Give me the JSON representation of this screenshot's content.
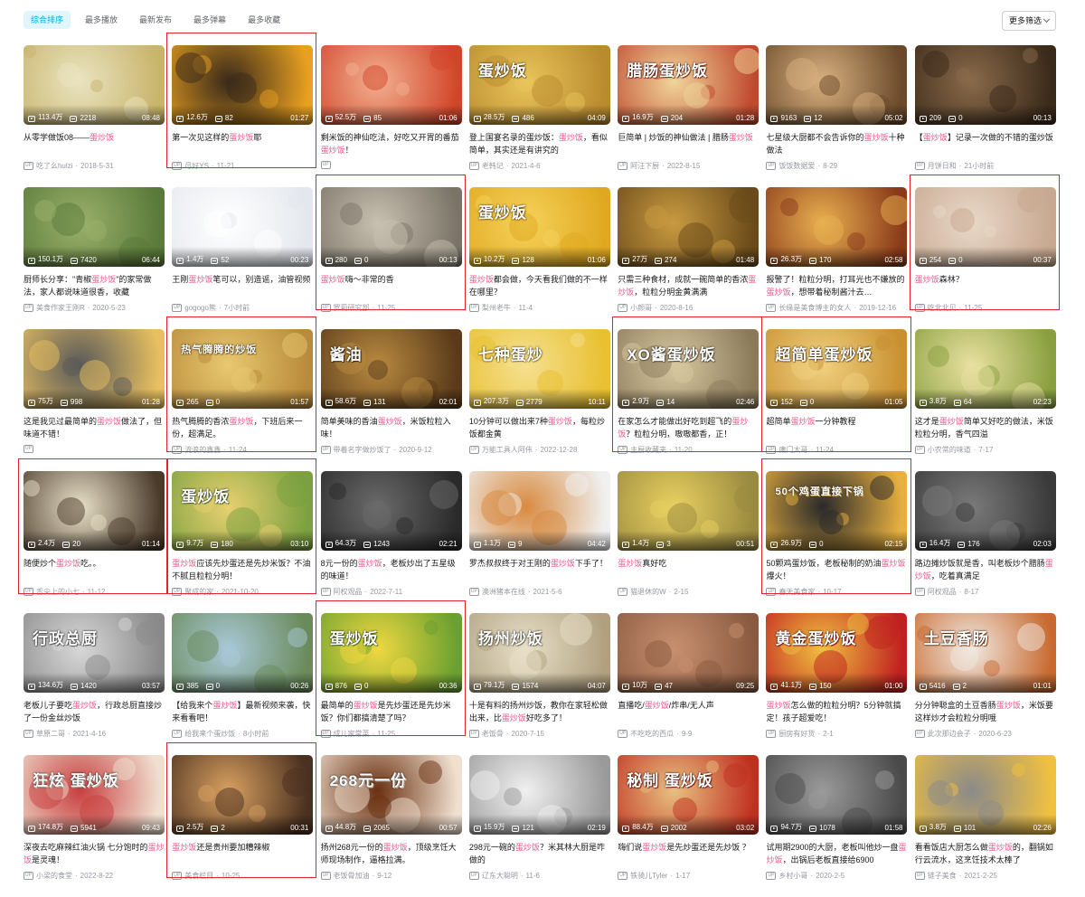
{
  "keyword": "蛋炒饭",
  "colors": {
    "accent": "#00aeec",
    "keyword": "#f25d8e",
    "highlight_box": "#e0242e"
  },
  "sort_tabs": [
    {
      "label": "综合排序",
      "active": true
    },
    {
      "label": "最多播放",
      "active": false
    },
    {
      "label": "最新发布",
      "active": false
    },
    {
      "label": "最多弹幕",
      "active": false
    },
    {
      "label": "最多收藏",
      "active": false
    }
  ],
  "filter_button": {
    "label": "更多筛选",
    "icon": "chevron-down-icon"
  },
  "videos": [
    {
      "title": [
        "从零学做饭08——",
        "蛋炒饭"
      ],
      "plays": "113.4万",
      "danmaku": "2218",
      "duration": "08:48",
      "author": "吃了么hulzi",
      "date": "2018-5-31",
      "highlighted": false,
      "thumb": {
        "c1": "#e9e3c0",
        "c2": "#c8b46a",
        "text": ""
      }
    },
    {
      "title": [
        "第一次见这样的",
        "蛋炒饭",
        "耶"
      ],
      "plays": "12.6万",
      "danmaku": "82",
      "duration": "01:27",
      "author": "尽好YS",
      "date": "11-21",
      "highlighted": true,
      "thumb": {
        "c1": "#3a2a1a",
        "c2": "#e8a020",
        "text": ""
      }
    },
    {
      "title": [
        "剩米饭的神仙吃法，好吃又开胃的番茄",
        "蛋炒饭",
        "！"
      ],
      "plays": "52.5万",
      "danmaku": "85",
      "duration": "01:06",
      "author": "",
      "date": "",
      "highlighted": false,
      "thumb": {
        "c1": "#f2b090",
        "c2": "#d2452a",
        "text": ""
      }
    },
    {
      "title": [
        "登上国宴名录的蛋炒饭：",
        "蛋炒饭",
        "，看似简单，其实还是有讲究的"
      ],
      "plays": "28.5万",
      "danmaku": "486",
      "duration": "04:09",
      "author": "老韩记",
      "date": "2021-4-6",
      "highlighted": false,
      "thumb": {
        "c1": "#e8c45a",
        "c2": "#b98a2e",
        "text": "蛋炒饭"
      }
    },
    {
      "title": [
        "巨简单 | 炒饭的神仙做法 | 腊肠",
        "蛋炒饭"
      ],
      "plays": "16.9万",
      "danmaku": "204",
      "duration": "01:28",
      "author": "阿汪下厨",
      "date": "2022-8-15",
      "highlighted": false,
      "thumb": {
        "c1": "#f0d59a",
        "c2": "#c0482e",
        "text": "腊肠蛋炒饭"
      }
    },
    {
      "title": [
        "七星级大厨都不会告诉你的",
        "蛋炒饭",
        "十种做法"
      ],
      "plays": "9163",
      "danmaku": "12",
      "duration": "05:02",
      "author": "饭饭数据爱",
      "date": "8-29",
      "highlighted": false,
      "thumb": {
        "c1": "#d8b080",
        "c2": "#6a4a2a",
        "text": ""
      }
    },
    {
      "title": [
        "【",
        "蛋炒饭",
        "】记录一次做的不错的蛋炒饭"
      ],
      "plays": "209",
      "danmaku": "0",
      "duration": "00:13",
      "author": "月饼日和",
      "date": "21小时前",
      "highlighted": false,
      "thumb": {
        "c1": "#8a6a4a",
        "c2": "#3a2a1a",
        "text": ""
      }
    },
    {
      "title": [
        "厨师长分享：\"青椒",
        "蛋炒饭",
        "\"的家常做法，家人都说味道很香，收藏"
      ],
      "plays": "150.1万",
      "danmaku": "7420",
      "duration": "06:44",
      "author": "美食作家王刚R",
      "date": "2020-5-23",
      "highlighted": false,
      "thumb": {
        "c1": "#9ab06a",
        "c2": "#5a7a3a",
        "text": ""
      }
    },
    {
      "title": [
        "王刚",
        "蛋炒饭",
        "笔可以，别造谣，油管视频"
      ],
      "plays": "1.4万",
      "danmaku": "52",
      "duration": "00:23",
      "author": "gogogo熊",
      "date": "7小时前",
      "highlighted": false,
      "thumb": {
        "c1": "#ffffff",
        "c2": "#e4e8ee",
        "text": ""
      }
    },
    {
      "title": [
        "蛋炒饭",
        "嗨～非常的香"
      ],
      "plays": "280",
      "danmaku": "0",
      "duration": "00:13",
      "author": "罗莉研究部",
      "date": "11-25",
      "highlighted": true,
      "thumb": {
        "c1": "#c8c0b0",
        "c2": "#7a7468",
        "text": ""
      }
    },
    {
      "title": [
        "蛋炒饭",
        "都会做，今天看我们做的不一样在哪里？"
      ],
      "plays": "10.2万",
      "danmaku": "128",
      "duration": "01:06",
      "author": "梨州老牛",
      "date": "11-4",
      "highlighted": false,
      "thumb": {
        "c1": "#f5d25a",
        "c2": "#e0a820",
        "text": "蛋炒饭"
      }
    },
    {
      "title": [
        "只需三种食材，成就一碗简单的香浓",
        "蛋炒饭",
        "，粒粒分明金黄满满"
      ],
      "plays": "27万",
      "danmaku": "274",
      "duration": "01:48",
      "author": "小颜哥",
      "date": "2020-8-16",
      "highlighted": false,
      "thumb": {
        "c1": "#c89a40",
        "c2": "#6a4a1a",
        "text": ""
      }
    },
    {
      "title": [
        "报警了！粒粒分明，打耳光也不嫌放的",
        "蛋炒饭",
        "，想带着秘制酱汁去…"
      ],
      "plays": "26.3万",
      "danmaku": "170",
      "duration": "02:58",
      "author": "长缘是美食博主的女人",
      "date": "2019-12-16",
      "highlighted": false,
      "thumb": {
        "c1": "#e8b050",
        "c2": "#8a3a1a",
        "text": ""
      }
    },
    {
      "title": [
        "蛋炒饭",
        "森林？"
      ],
      "plays": "254",
      "danmaku": "0",
      "duration": "00:37",
      "author": "吃北北贝",
      "date": "11-25",
      "highlighted": true,
      "thumb": {
        "c1": "#e8d8c8",
        "c2": "#c8a890",
        "text": ""
      }
    },
    {
      "title": [
        "这是我见过最简单的",
        "蛋炒饭",
        "做法了，但味道不错！"
      ],
      "plays": "75万",
      "danmaku": "998",
      "duration": "01:28",
      "author": "",
      "date": "",
      "highlighted": false,
      "thumb": {
        "c1": "#5a5a5a",
        "c2": "#e8c060",
        "text": ""
      }
    },
    {
      "title": [
        "热气腾腾的香浓",
        "蛋炒饭",
        "，下班后来一份，超满足。"
      ],
      "plays": "265",
      "danmaku": "0",
      "duration": "01:57",
      "author": "流浪的鑫鑫",
      "date": "11-24",
      "highlighted": true,
      "thumb": {
        "c1": "#e8c870",
        "c2": "#b88a3a",
        "text": "热气腾腾的炒饭"
      }
    },
    {
      "title": [
        "简单美味的香油",
        "蛋炒饭",
        "，米饭粒粒入味！"
      ],
      "plays": "58.6万",
      "danmaku": "131",
      "duration": "02:01",
      "author": "带着名字做炒饭了",
      "date": "2020-9-12",
      "highlighted": false,
      "thumb": {
        "c1": "#b88a40",
        "c2": "#5a3a1a",
        "text": "酱油"
      }
    },
    {
      "title": [
        "10分钟可以做出来7种",
        "蛋炒饭",
        "，每粒炒饭都金黄"
      ],
      "plays": "207.3万",
      "danmaku": "2779",
      "duration": "10:11",
      "author": "万能工具人阿伟",
      "date": "2022-12-28",
      "highlighted": false,
      "thumb": {
        "c1": "#f5e090",
        "c2": "#e8c030",
        "text": "七种蛋炒"
      }
    },
    {
      "title": [
        "在家怎么才能做出好吃到超飞的",
        "蛋炒饭",
        "？粒粒分明，嗷嗷都香，正！"
      ],
      "plays": "2.9万",
      "danmaku": "14",
      "duration": "02:46",
      "author": "主厨收藏夹",
      "date": "11-20",
      "highlighted": true,
      "thumb": {
        "c1": "#d8c8a0",
        "c2": "#8a7a5a",
        "text": "XO酱蛋炒饭"
      }
    },
    {
      "title": [
        "超简单",
        "蛋炒饭",
        "一分钟教程"
      ],
      "plays": "152",
      "danmaku": "0",
      "duration": "01:05",
      "author": "庸门大哥",
      "date": "11-24",
      "highlighted": true,
      "thumb": {
        "c1": "#f0d080",
        "c2": "#c89030",
        "text": "超简单蛋炒饭"
      }
    },
    {
      "title": [
        "这才是",
        "蛋炒饭",
        "简单又好吃的做法，米饭粒粒分明，香气四溢"
      ],
      "plays": "3.8万",
      "danmaku": "64",
      "duration": "02:23",
      "author": "小农常的味道",
      "date": "7-17",
      "highlighted": false,
      "thumb": {
        "c1": "#e8e0a0",
        "c2": "#8aa040",
        "text": ""
      }
    },
    {
      "title": [
        "随便炒个",
        "蛋炒饭",
        "吃。。"
      ],
      "plays": "2.4万",
      "danmaku": "20",
      "duration": "01:14",
      "author": "舌尖上的小七",
      "date": "11-12",
      "highlighted": true,
      "thumb": {
        "c1": "#e8e0c8",
        "c2": "#4a3a2a",
        "text": ""
      }
    },
    {
      "title": [
        "蛋炒饭",
        "应该先炒蛋还是先炒米饭？不油不腻且粒粒分明！"
      ],
      "plays": "9.7万",
      "danmaku": "180",
      "duration": "03:10",
      "author": "聚成的家",
      "date": "2021-10-20",
      "highlighted": true,
      "thumb": {
        "c1": "#e8d070",
        "c2": "#7aa040",
        "text": "蛋炒饭"
      }
    },
    {
      "title": [
        "8元一份的",
        "蛋炒饭",
        "，老板炒出了五星级的味道！"
      ],
      "plays": "64.3万",
      "danmaku": "1243",
      "duration": "02:21",
      "author": "阿权观品",
      "date": "2022-7-11",
      "highlighted": false,
      "thumb": {
        "c1": "#6a6a6a",
        "c2": "#2a2a2a",
        "text": ""
      }
    },
    {
      "title": [
        "罗杰叔叔终于对王刚的",
        "蛋炒饭",
        "下手了！"
      ],
      "plays": "1.1万",
      "danmaku": "9",
      "duration": "04:42",
      "author": "澳洲猪本在线",
      "date": "2021-5-6",
      "highlighted": false,
      "thumb": {
        "c1": "#d88a40",
        "c2": "#f0f0f0",
        "text": ""
      }
    },
    {
      "title": [
        "蛋炒饭",
        "真好吃"
      ],
      "plays": "1.4万",
      "danmaku": "3",
      "duration": "00:51",
      "author": "猫退休的W",
      "date": "2-15",
      "highlighted": false,
      "thumb": {
        "c1": "#e8d060",
        "c2": "#9a8a40",
        "text": ""
      }
    },
    {
      "title": [
        "50颗鸡蛋炒饭，老板秘制的奶油",
        "蛋炒饭",
        "爆火！"
      ],
      "plays": "26.9万",
      "danmaku": "0",
      "duration": "02:15",
      "author": "春天美食家",
      "date": "10-17",
      "highlighted": true,
      "thumb": {
        "c1": "#2a2a2a",
        "c2": "#e8b040",
        "text": "50个鸡蛋直接下锅"
      }
    },
    {
      "title": [
        "路边摊炒饭就是香，叫老板炒个腊肠",
        "蛋炒饭",
        "，吃着真满足"
      ],
      "plays": "16.4万",
      "danmaku": "176",
      "duration": "02:03",
      "author": "阿权观品",
      "date": "8-17",
      "highlighted": false,
      "thumb": {
        "c1": "#7a7a7a",
        "c2": "#3a3a3a",
        "text": ""
      }
    },
    {
      "title": [
        "老板儿子要吃",
        "蛋炒饭",
        "，行政总厨直接炒了一份金丝炒饭"
      ],
      "plays": "134.6万",
      "danmaku": "1420",
      "duration": "03:57",
      "author": "草原二哥",
      "date": "2021-4-16",
      "highlighted": false,
      "thumb": {
        "c1": "#d8d8d8",
        "c2": "#8a8a8a",
        "text": "行政总厨"
      }
    },
    {
      "title": [
        "【给我来个",
        "蛋炒饭",
        "】最新视频来袭，快来看看吧！"
      ],
      "plays": "385",
      "danmaku": "0",
      "duration": "00:26",
      "author": "给我来个蛋炒饭",
      "date": "8小时前",
      "highlighted": false,
      "thumb": {
        "c1": "#a8c8d8",
        "c2": "#6a8a5a",
        "text": ""
      }
    },
    {
      "title": [
        "最简单的",
        "蛋炒饭",
        "是先炒蛋还是先炒米饭？你们都搞清楚了吗？"
      ],
      "plays": "876",
      "danmaku": "0",
      "duration": "00:36",
      "author": "成儿家常菜",
      "date": "11-25",
      "highlighted": true,
      "thumb": {
        "c1": "#f0d840",
        "c2": "#6aa030",
        "text": "蛋炒饭"
      }
    },
    {
      "title": [
        "十是有料的扬州炒饭，教你在家轻松做出来，比",
        "蛋炒饭",
        "好吃多了！"
      ],
      "plays": "79.1万",
      "danmaku": "1574",
      "duration": "04:07",
      "author": "老饭骨",
      "date": "2020-7-15",
      "highlighted": false,
      "thumb": {
        "c1": "#e8e0c8",
        "c2": "#b0a080",
        "text": "扬州炒饭"
      }
    },
    {
      "title": [
        "直播吃/",
        "蛋炒饭",
        "/炸串/无人声"
      ],
      "plays": "10万",
      "danmaku": "47",
      "duration": "09:25",
      "author": "不吃吃的西瓜",
      "date": "9-9",
      "highlighted": false,
      "thumb": {
        "c1": "#c89070",
        "c2": "#8a5a40",
        "text": ""
      }
    },
    {
      "title": [
        "蛋炒饭",
        "怎么做的粒粒分明？5分钟就搞定！孩子超爱吃！"
      ],
      "plays": "41.1万",
      "danmaku": "150",
      "duration": "01:00",
      "author": "厨房有好货",
      "date": "2-1",
      "highlighted": false,
      "thumb": {
        "c1": "#f0c040",
        "c2": "#c02020",
        "text": "黄金蛋炒饭"
      }
    },
    {
      "title": [
        "分分钟聪盒的土豆香肠",
        "蛋炒饭",
        "，米饭要这样炒才会粒粒分明哦"
      ],
      "plays": "5416",
      "danmaku": "2",
      "duration": "01:01",
      "author": "此次那边会子",
      "date": "2020-6-23",
      "highlighted": false,
      "thumb": {
        "c1": "#f0e8e0",
        "c2": "#c86a30",
        "text": "土豆香肠"
      }
    },
    {
      "title": [
        "深夜去吃麻辣红油火锅 七分饱时的",
        "蛋炒饭",
        "是灵魂！"
      ],
      "plays": "174.8万",
      "danmaku": "5941",
      "duration": "09:43",
      "author": "小梁的食堂",
      "date": "2022-8-22",
      "highlighted": false,
      "thumb": {
        "c1": "#c84040",
        "c2": "#f0e0d0",
        "text": "狂炫 蛋炒饭"
      }
    },
    {
      "title": [
        "蛋炒饭",
        "还是贵州要加糟辣椒"
      ],
      "plays": "2.5万",
      "danmaku": "2",
      "duration": "00:31",
      "author": "美食栏目",
      "date": "10-25",
      "highlighted": true,
      "thumb": {
        "c1": "#d8a060",
        "c2": "#4a3020",
        "text": ""
      }
    },
    {
      "title": [
        "扬州268元一份的",
        "蛋炒饭",
        "，顶级烹饪大师现场制作，逼格拉满。"
      ],
      "plays": "44.8万",
      "danmaku": "2065",
      "duration": "00:57",
      "author": "老饭骨加油",
      "date": "9-12",
      "highlighted": false,
      "thumb": {
        "c1": "#6a3010",
        "c2": "#f0e0d0",
        "text": "268元一份"
      }
    },
    {
      "title": [
        "298元一碗的",
        "蛋炒饭",
        "？米其林大厨是咋做的"
      ],
      "plays": "15.9万",
      "danmaku": "121",
      "duration": "02:19",
      "author": "辽东大聪明",
      "date": "11-6",
      "highlighted": false,
      "thumb": {
        "c1": "#f0f0f0",
        "c2": "#9a9a9a",
        "text": ""
      }
    },
    {
      "title": [
        "嗨们说",
        "蛋炒饭",
        "是先炒蛋还是先炒饭 ？"
      ],
      "plays": "88.4万",
      "danmaku": "2002",
      "duration": "03:02",
      "author": "铁骑儿Tyler",
      "date": "1-17",
      "highlighted": false,
      "thumb": {
        "c1": "#e8c080",
        "c2": "#c03020",
        "text": "秘制 蛋炒饭"
      }
    },
    {
      "title": [
        "试用期2900的大厨，老板叫他炒一盘",
        "蛋炒饭",
        "，出锅后老板直接给6900"
      ],
      "plays": "94.7万",
      "danmaku": "1078",
      "duration": "01:58",
      "author": "乡村小哥",
      "date": "2020-2-5",
      "highlighted": false,
      "thumb": {
        "c1": "#9a9a9a",
        "c2": "#4a4a4a",
        "text": ""
      }
    },
    {
      "title": [
        "看看饭店大厨怎么做",
        "蛋炒饭",
        "的，翻锅如行云流水，这烹饪技术太棒了"
      ],
      "plays": "3.8万",
      "danmaku": "101",
      "duration": "02:26",
      "author": "链子美食",
      "date": "2021-2-25",
      "highlighted": false,
      "thumb": {
        "c1": "#8a8a8a",
        "c2": "#f0c040",
        "text": ""
      }
    }
  ]
}
